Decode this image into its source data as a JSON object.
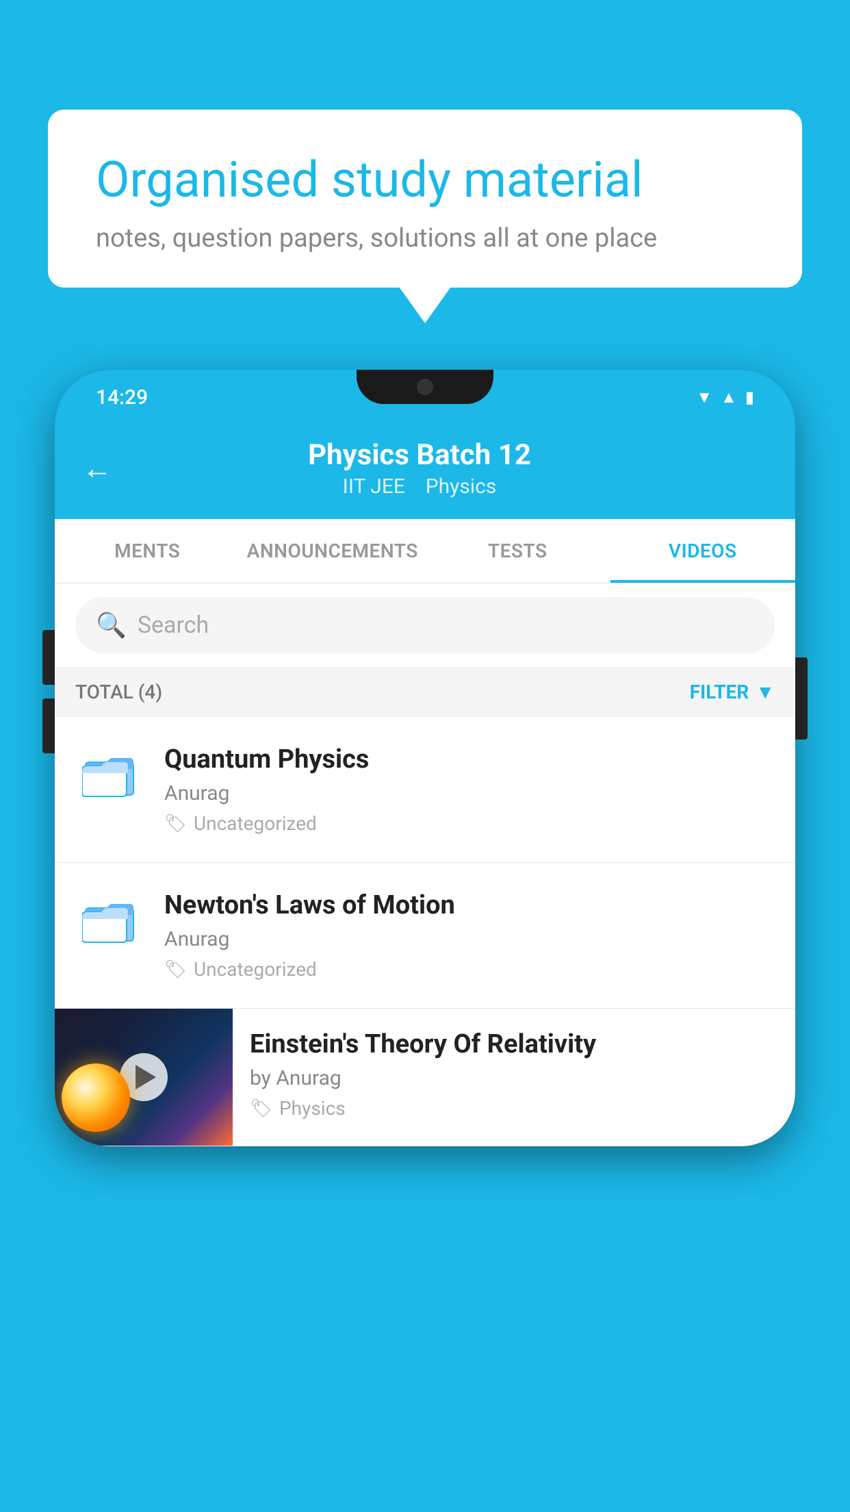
{
  "background": {
    "color": "#1BB8E8"
  },
  "speech_bubble": {
    "title": "Organised study material",
    "subtitle": "notes, question papers, solutions all at one place"
  },
  "phone": {
    "status_bar": {
      "time": "14:29"
    },
    "header": {
      "title": "Physics Batch 12",
      "subtitle_part1": "IIT JEE",
      "subtitle_part2": "Physics",
      "back_label": "←"
    },
    "tabs": [
      {
        "label": "MENTS",
        "active": false
      },
      {
        "label": "ANNOUNCEMENTS",
        "active": false
      },
      {
        "label": "TESTS",
        "active": false
      },
      {
        "label": "VIDEOS",
        "active": true
      }
    ],
    "search": {
      "placeholder": "Search"
    },
    "filter_row": {
      "total_label": "TOTAL (4)",
      "filter_label": "FILTER"
    },
    "items": [
      {
        "type": "folder",
        "title": "Quantum Physics",
        "author": "Anurag",
        "tag": "Uncategorized"
      },
      {
        "type": "folder",
        "title": "Newton's Laws of Motion",
        "author": "Anurag",
        "tag": "Uncategorized"
      },
      {
        "type": "video",
        "title": "Einstein's Theory Of Relativity",
        "author": "by Anurag",
        "tag": "Physics"
      }
    ]
  }
}
